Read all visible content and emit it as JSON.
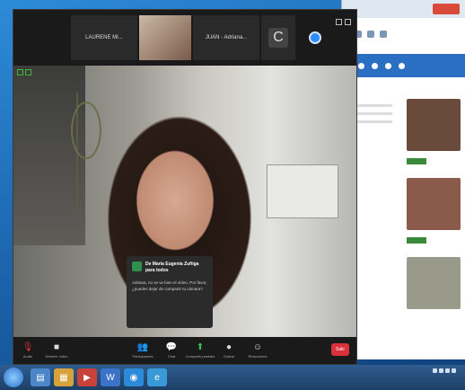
{
  "zoom": {
    "participants": [
      {
        "name": "LAURENE MI..."
      },
      {
        "name": ""
      },
      {
        "name": "JUAN - Adriana..."
      },
      {
        "initial": "C"
      },
      {
        "name": ""
      }
    ],
    "chat_popup": {
      "from": "De María Eugenia Zuñiga para todos",
      "message": "Adriana, no se ve bien el vídeo. Por favor, ¿puedes dejar de compartir tu cámara?"
    },
    "caption": "",
    "controls": [
      {
        "icon": "mic-off-icon",
        "label": "Audio",
        "glyph": "🎙"
      },
      {
        "icon": "video-icon",
        "label": "Detener video",
        "glyph": "■"
      },
      {
        "icon": "participants-icon",
        "label": "Participantes",
        "glyph": "👥"
      },
      {
        "icon": "chat-icon",
        "label": "Chat",
        "glyph": "💬"
      },
      {
        "icon": "share-screen-icon",
        "label": "Compartir pantalla",
        "glyph": "⬆"
      },
      {
        "icon": "record-icon",
        "label": "Grabar",
        "glyph": "●"
      },
      {
        "icon": "reactions-icon",
        "label": "Reacciones",
        "glyph": "☺"
      }
    ],
    "leave_label": "Salir"
  },
  "browser": {
    "feed": [
      {
        "text": "",
        "thumb_color": "#6a4a3a"
      },
      {
        "text": "",
        "thumb_color": "#8a5a4a"
      },
      {
        "text": "",
        "thumb_color": "#9a9a8a"
      }
    ]
  },
  "taskbar": {
    "clock_time": "",
    "clock_date": ""
  }
}
